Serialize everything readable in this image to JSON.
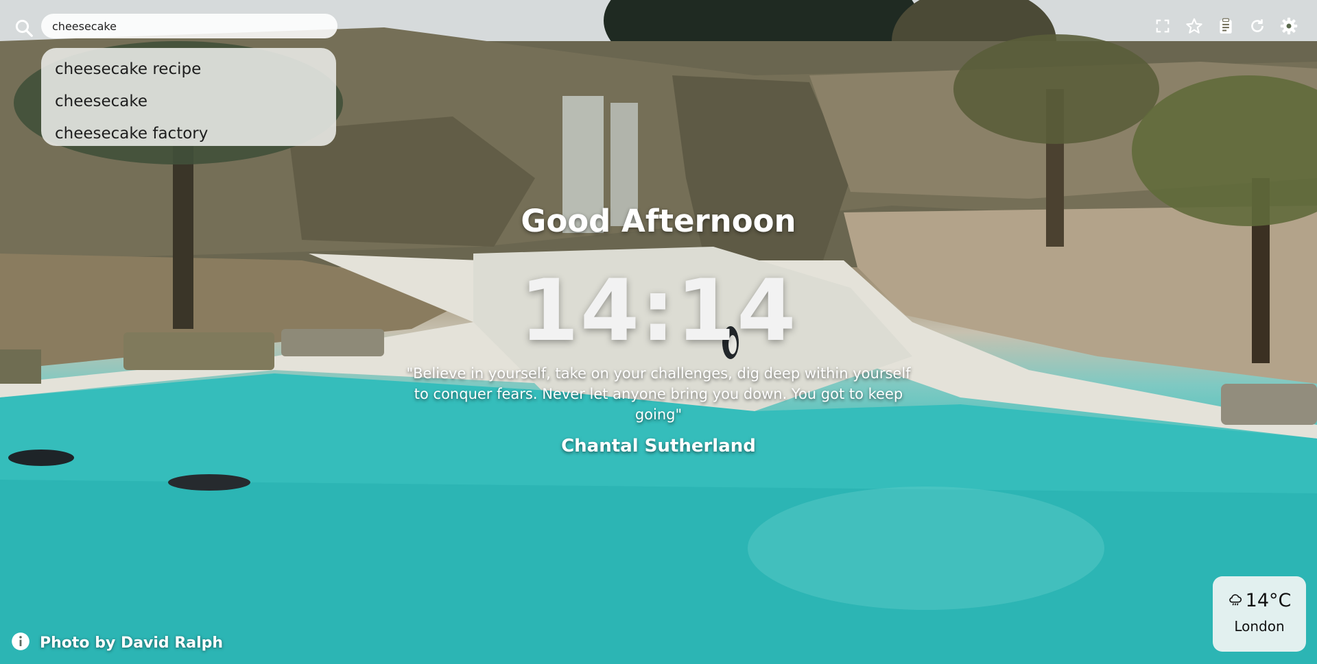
{
  "search": {
    "value": "cheesecake",
    "suggestions": [
      "cheesecake recipe",
      "cheesecake",
      "cheesecake factory"
    ]
  },
  "toolbar": {
    "icons": [
      "fullscreen-icon",
      "star-icon",
      "clipboard-icon",
      "refresh-icon",
      "gear-icon"
    ]
  },
  "main": {
    "greeting": "Good Afternoon",
    "time": "14:14",
    "quote": "\"Believe in yourself, take on your challenges, dig deep within yourself to conquer fears. Never let anyone bring you down. You got to keep going\"",
    "author": "Chantal Sutherland"
  },
  "credit": {
    "text": "Photo by David Ralph"
  },
  "weather": {
    "temperature": "14°C",
    "city": "London",
    "icon": "rain-cloud-icon"
  },
  "colors": {
    "water": "#2ab9b8",
    "panel": "#eceee9",
    "text": "#ffffff"
  }
}
